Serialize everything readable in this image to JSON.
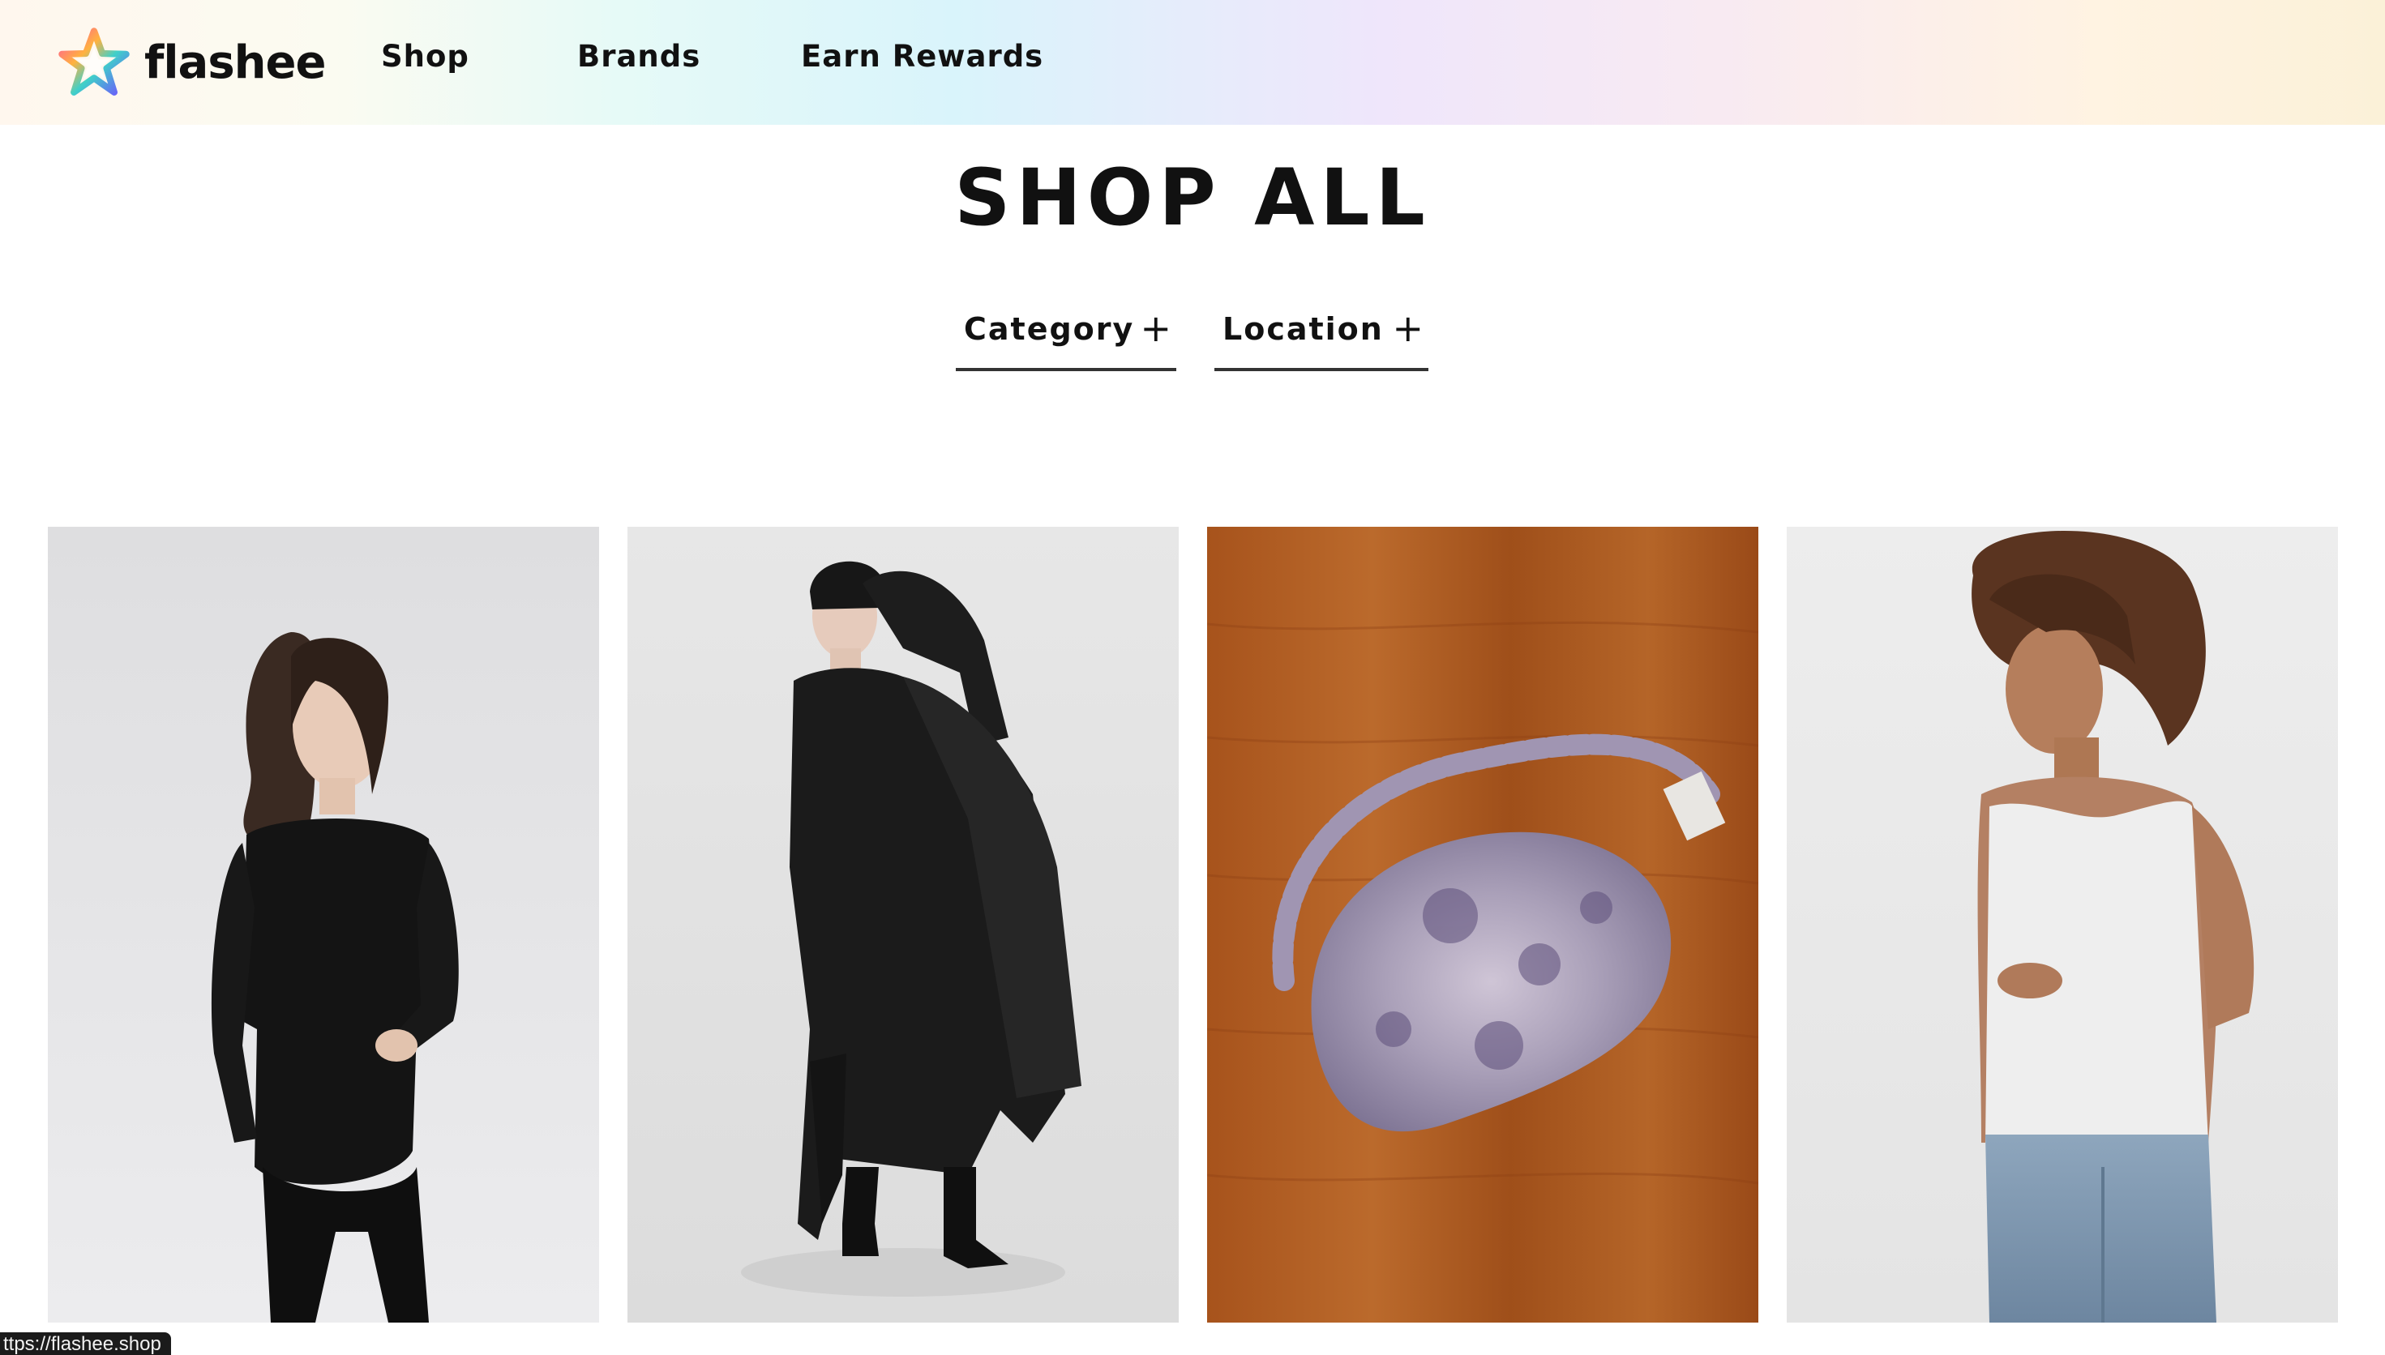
{
  "brand": {
    "name": "flashee",
    "logo_icon": "star-logo-icon"
  },
  "nav": {
    "items": [
      {
        "label": "Shop"
      },
      {
        "label": "Brands"
      },
      {
        "label": "Earn Rewards"
      }
    ]
  },
  "header_icons": [
    {
      "name": "search-icon"
    },
    {
      "name": "star-icon"
    },
    {
      "name": "shopping-bag-icon"
    },
    {
      "name": "account-icon"
    }
  ],
  "page": {
    "title": "SHOP ALL"
  },
  "filters": [
    {
      "label": "Category",
      "toggle": "+"
    },
    {
      "label": "Location",
      "toggle": "+"
    }
  ],
  "products": [
    {
      "image": "model in black fitted long-sleeve top and black leggings"
    },
    {
      "image": "model in oversized black dress with black headband and boots"
    },
    {
      "image": "tie-dyed silk sleep mask on wooden surface"
    },
    {
      "image": "curly-haired model in white tank top and jeans"
    }
  ],
  "status_bar": {
    "url": "ttps://flashee.shop"
  },
  "colors": {
    "text": "#111111",
    "background": "#ffffff",
    "status_bar": "#1b1b1b"
  }
}
